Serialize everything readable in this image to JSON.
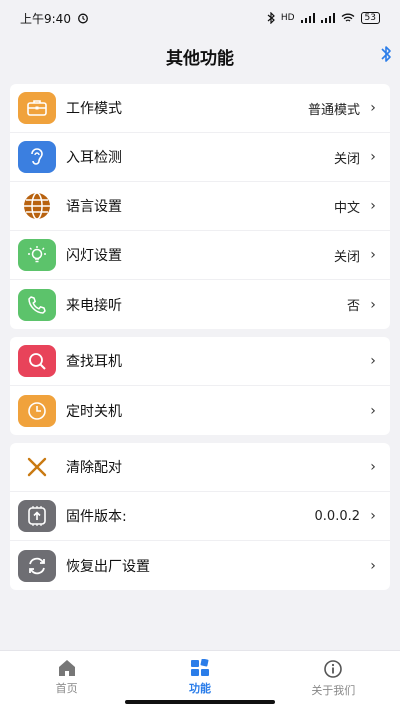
{
  "status": {
    "time": "上午9:40",
    "network_label": "HD",
    "battery": "53"
  },
  "header": {
    "title": "其他功能"
  },
  "colors": {
    "accent": "#2b7de9",
    "orange": "#f0a23c",
    "blue": "#3b7fe0",
    "brown": "#b8620f",
    "green": "#5cc36b",
    "red": "#e8435a",
    "gray": "#6e6e73"
  },
  "group1": [
    {
      "label": "工作模式",
      "value": "普通模式",
      "icon": "briefcase-icon"
    },
    {
      "label": "入耳检测",
      "value": "关闭",
      "icon": "ear-icon"
    },
    {
      "label": "语言设置",
      "value": "中文",
      "icon": "globe-icon"
    },
    {
      "label": "闪灯设置",
      "value": "关闭",
      "icon": "bulb-icon"
    },
    {
      "label": "来电接听",
      "value": "否",
      "icon": "phone-icon"
    }
  ],
  "group2": [
    {
      "label": "查找耳机",
      "icon": "search-icon"
    },
    {
      "label": "定时关机",
      "icon": "clock-icon"
    }
  ],
  "group3": [
    {
      "label": "清除配对",
      "icon": "cross-icon"
    },
    {
      "label": "固件版本:",
      "value": "0.0.0.2",
      "icon": "firmware-icon"
    },
    {
      "label": "恢复出厂设置",
      "icon": "reset-icon"
    }
  ],
  "tabs": [
    {
      "label": "首页",
      "icon": "home-icon",
      "active": false
    },
    {
      "label": "功能",
      "icon": "grid-icon",
      "active": true
    },
    {
      "label": "关于我们",
      "icon": "info-icon",
      "active": false
    }
  ]
}
